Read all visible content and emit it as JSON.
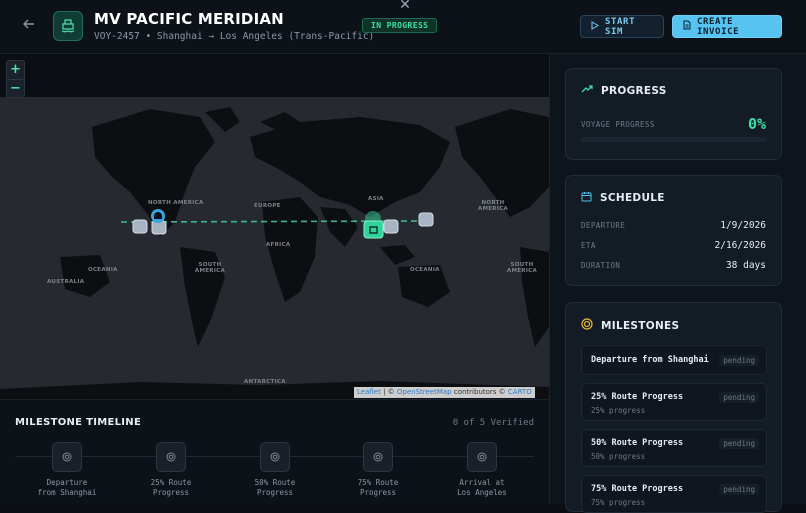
{
  "header": {
    "title": "MV PACIFIC MERIDIAN",
    "subtitle": "VOY-2457 • Shanghai → Los Angeles (Trans-Pacific)",
    "status": "IN PROGRESS",
    "start_sim_label": "START SIM",
    "create_invoice_label": "CREATE INVOICE",
    "close_glyph": "✕"
  },
  "map": {
    "zoom_in": "+",
    "zoom_out": "−",
    "attribution": {
      "leaflet": "Leaflet",
      "sep": " | © ",
      "osm": "OpenStreetMap",
      "contrib": " contributors © ",
      "carto": "CARTO"
    },
    "labels": {
      "north_america_left": "NORTH AMERICA",
      "north_america_right": "NORTH AMERICA",
      "europe": "EUROPE",
      "asia": "ASIA",
      "africa": "AFRICA",
      "south_america_left": "SOUTH AMERICA",
      "south_america_right": "SOUTH AMERICA",
      "australia_left": "AUSTRALIA",
      "oceania_left": "OCEANIA",
      "oceania_right": "OCEANIA",
      "antarctica": "ANTARCTICA"
    }
  },
  "timeline": {
    "title": "MILESTONE TIMELINE",
    "count": "0 of 5 Verified",
    "steps": [
      {
        "line1": "Departure",
        "line2": "from Shanghai"
      },
      {
        "line1": "25% Route",
        "line2": "Progress"
      },
      {
        "line1": "50% Route",
        "line2": "Progress"
      },
      {
        "line1": "75% Route",
        "line2": "Progress"
      },
      {
        "line1": "Arrival at",
        "line2": "Los Angeles"
      }
    ]
  },
  "progress": {
    "title": "PROGRESS",
    "label": "VOYAGE PROGRESS",
    "value": "0%",
    "fraction": 0
  },
  "schedule": {
    "title": "SCHEDULE",
    "departure_label": "DEPARTURE",
    "departure": "1/9/2026",
    "eta_label": "ETA",
    "eta": "2/16/2026",
    "duration_label": "DURATION",
    "duration": "38 days"
  },
  "milestones": {
    "title": "MILESTONES",
    "items": [
      {
        "name": "Departure from Shanghai",
        "sub": "",
        "status": "pending"
      },
      {
        "name": "25% Route Progress",
        "sub": "25% progress",
        "status": "pending"
      },
      {
        "name": "50% Route Progress",
        "sub": "50% progress",
        "status": "pending"
      },
      {
        "name": "75% Route Progress",
        "sub": "75% progress",
        "status": "pending"
      }
    ]
  },
  "colors": {
    "accent_green": "#38e1a8",
    "accent_blue": "#56c3f0",
    "background": "#0b0f14"
  }
}
